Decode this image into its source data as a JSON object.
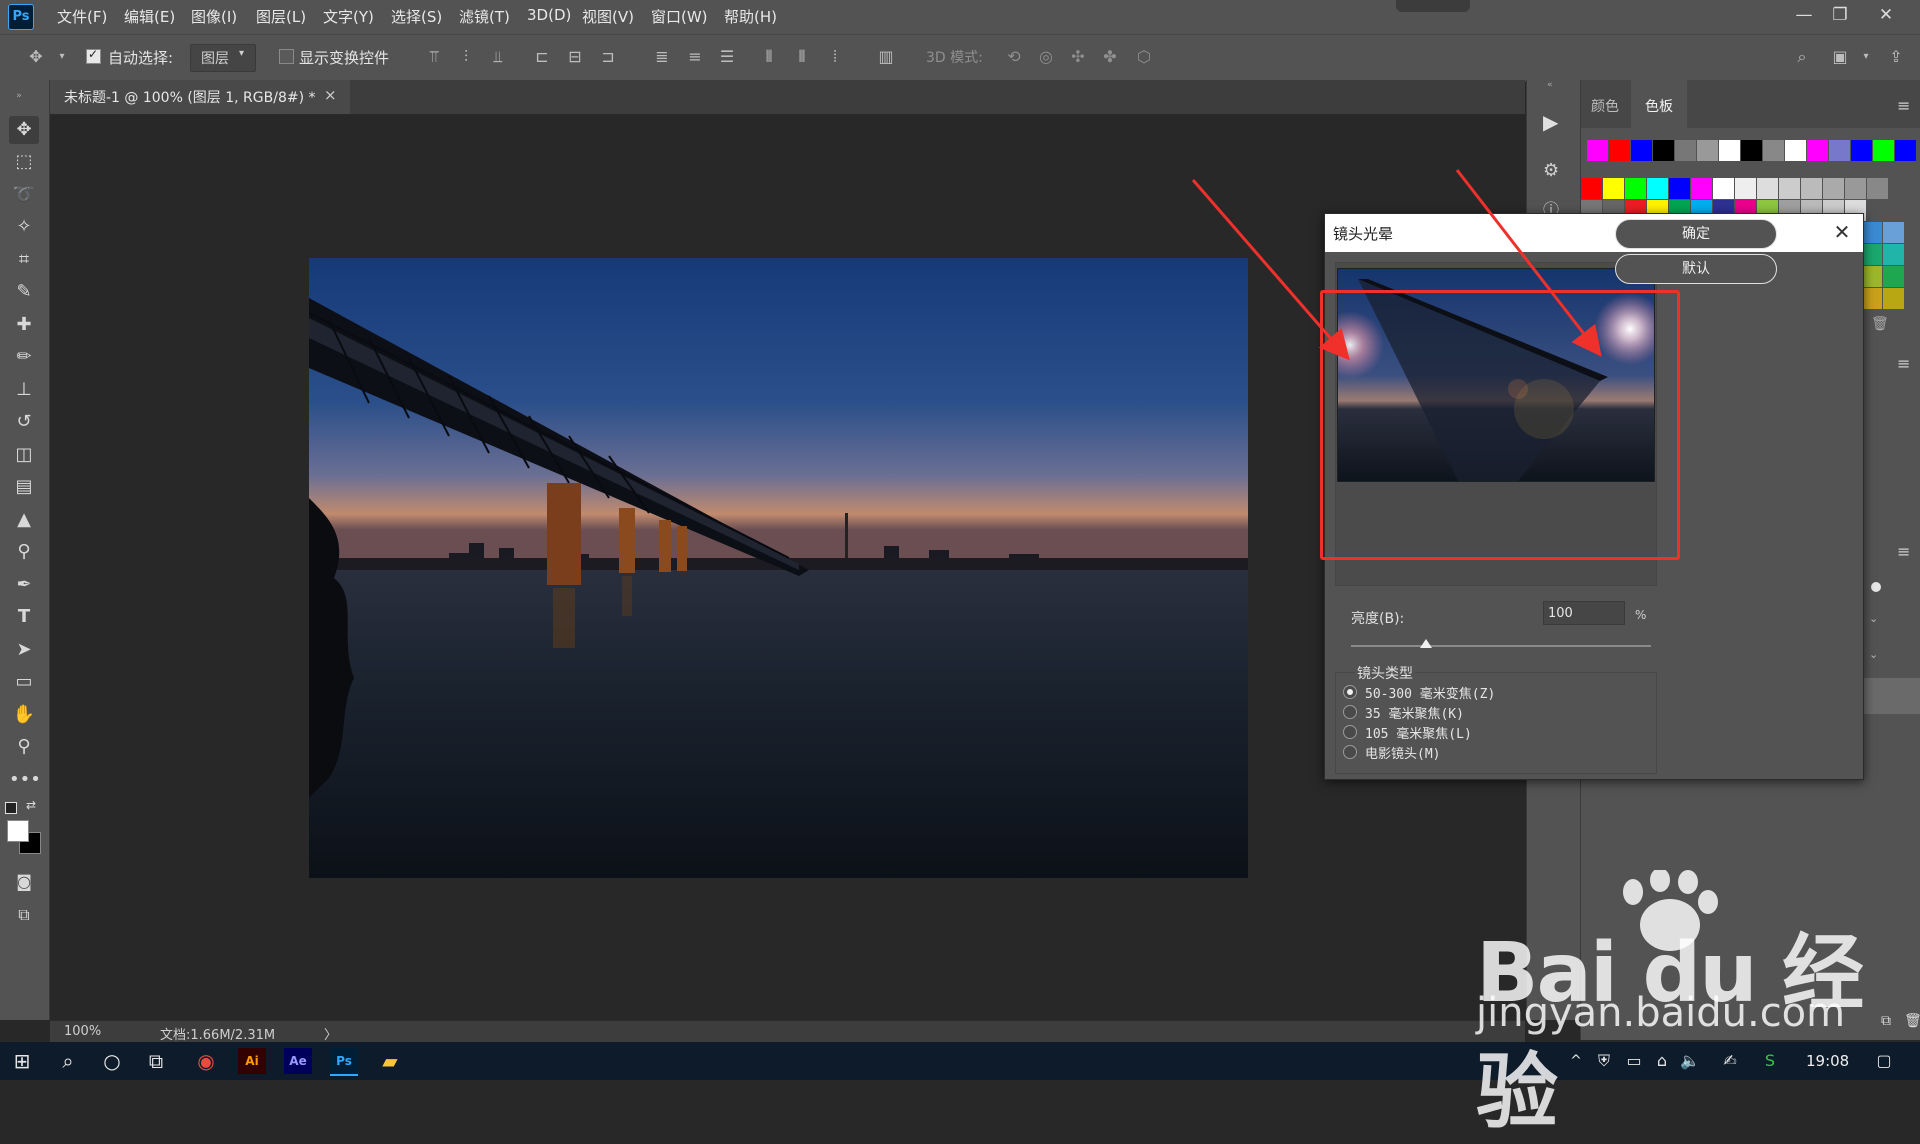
{
  "app": {
    "logo": "Ps",
    "time": "19:08"
  },
  "menu": [
    "文件(F)",
    "编辑(E)",
    "图像(I)",
    "图层(L)",
    "文字(Y)",
    "选择(S)",
    "滤镜(T)",
    "3D(D)",
    "视图(V)",
    "窗口(W)",
    "帮助(H)"
  ],
  "options": {
    "auto_select_label": "自动选择:",
    "auto_select_checked": true,
    "layer_mode": "图层",
    "show_transform_label": "显示变换控件",
    "show_transform_checked": false,
    "mode_3d_label": "3D 模式:"
  },
  "document": {
    "tab_title": "未标题-1 @ 100% (图层 1, RGB/8#) *",
    "close": "×"
  },
  "status": {
    "zoom": "100%",
    "doc": "文档:1.66M/2.31M",
    "arrow": "〉"
  },
  "panels": {
    "tab_color": "颜色",
    "tab_swatches": "色板",
    "menu_icon": "≡"
  },
  "swatch_colors": {
    "row1": [
      "#ff00ff",
      "#ff0000",
      "#0000ff",
      "#000000",
      "#777777",
      "#999999",
      "#ffffff",
      "#000000",
      "#888888",
      "#ffffff",
      "#ff00ff",
      "#7777cc",
      "#0000ff",
      "#00ff00",
      "#0000ff"
    ],
    "row2": [
      "#ff0000",
      "#ffff00",
      "#00ff00",
      "#00ffff",
      "#0000ff",
      "#ff00ff",
      "#ffffff",
      "#eeeeee",
      "#dddddd",
      "#cccccc",
      "#bbbbbb",
      "#aaaaaa",
      "#999999",
      "#888888"
    ],
    "row3": [
      "#777777",
      "#666666",
      "#ed1c24",
      "#fff200",
      "#00a651",
      "#00aeef",
      "#2e3192",
      "#ec008c",
      "#8dc63f",
      "#a0a0a0",
      "#bbbbbb",
      "#cccccc",
      "#dddddd"
    ]
  },
  "dialog": {
    "title": "镜头光晕",
    "ok": "确定",
    "default": "默认",
    "brightness_label": "亮度(B):",
    "brightness_value": "100",
    "brightness_unit": "%",
    "brightness_slider_fraction": 0.25,
    "lens_type_label": "镜头类型",
    "lens_options": [
      "50-300 毫米变焦(Z)",
      "35 毫米聚焦(K)",
      "105 毫米聚焦(L)",
      "电影镜头(M)"
    ],
    "lens_selected": 0
  },
  "watermark": {
    "line1": "Bai du 经验",
    "line2": "jingyan.baidu.com"
  },
  "colors": {
    "annotation_red": "#f0302a",
    "ps_blue": "#31a8ff",
    "panel_bg": "#535353"
  }
}
